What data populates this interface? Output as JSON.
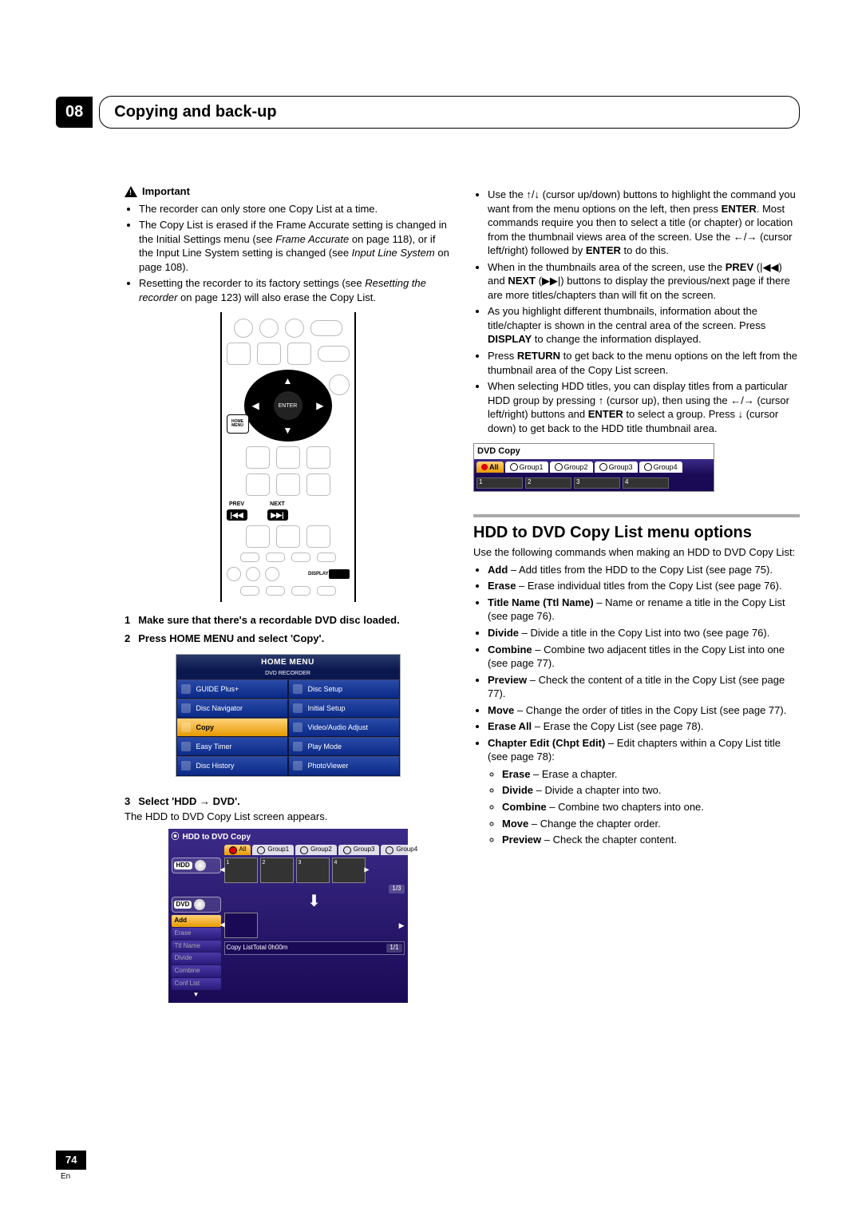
{
  "chapter": {
    "number": "08",
    "title": "Copying and back-up"
  },
  "important": {
    "label": "Important",
    "items": [
      {
        "text": "The recorder can only store one Copy List at a time."
      },
      {
        "text_parts": [
          "The Copy List is erased if the Frame Accurate setting is changed in the Initial Settings menu (see ",
          "Frame Accurate",
          " on page 118), or if the Input Line System setting is changed (see ",
          "Input Line System",
          " on page 108)."
        ]
      },
      {
        "text_parts": [
          "Resetting the recorder to its factory settings (see ",
          "Resetting the recorder",
          " on page 123) will also erase the Copy List."
        ]
      }
    ]
  },
  "remote": {
    "enter": "ENTER",
    "home_menu": "HOME\nMENU",
    "prev": "PREV",
    "next": "NEXT",
    "display": "DISPLAY"
  },
  "steps": {
    "s1": {
      "num": "1",
      "text": "Make sure that there's a recordable DVD disc loaded."
    },
    "s2": {
      "num": "2",
      "text": "Press HOME MENU and select 'Copy'."
    },
    "s3": {
      "num": "3",
      "text": "Select 'HDD → DVD'."
    },
    "s3_sub": "The HDD to DVD Copy List screen appears."
  },
  "home_menu": {
    "header": "HOME MENU",
    "sub": "DVD RECORDER",
    "left": [
      "GUIDE Plus+",
      "Disc Navigator",
      "Copy",
      "Easy Timer",
      "Disc History"
    ],
    "right": [
      "Disc Setup",
      "Initial Setup",
      "Video/Audio Adjust",
      "Play Mode",
      "PhotoViewer"
    ]
  },
  "copy_fig": {
    "title": "HDD to DVD Copy",
    "tabs": [
      "All",
      "Group1",
      "Group2",
      "Group3",
      "Group4"
    ],
    "hdd": "HDD",
    "dvd": "DVD",
    "thumbs": [
      "1",
      "2",
      "3",
      "4"
    ],
    "page1": "1/3",
    "copylist": "Copy List",
    "total": "Total  0h00m",
    "page2": "1/1",
    "menu": [
      "Add",
      "Erase",
      "Ttl Name",
      "Divide",
      "Combine",
      "Conf List"
    ]
  },
  "right_bullets": [
    {
      "parts": [
        "Use the ",
        "↑",
        "/",
        "↓",
        " (cursor up/down) buttons to highlight the command you want from the menu options on the left, then press ",
        "ENTER",
        ". Most commands require you then to select a title (or chapter) or location from the thumbnail views area of the screen. Use the ",
        "←",
        "/",
        "→",
        " (cursor left/right) followed by ",
        "ENTER",
        " to do this."
      ]
    },
    {
      "parts": [
        "When in the thumbnails area of the screen, use the ",
        "PREV",
        " (|◀◀) and ",
        "NEXT",
        " (▶▶|) buttons to display the previous/next page if there are more titles/chapters than will fit on the screen."
      ]
    },
    {
      "parts": [
        "As you highlight different thumbnails, information about the title/chapter is shown in the central area of the screen. Press ",
        "DISPLAY",
        " to change the information displayed."
      ]
    },
    {
      "parts": [
        "Press ",
        "RETURN",
        " to get back to the menu options on the left from the thumbnail area of the Copy List screen."
      ]
    },
    {
      "parts": [
        "When selecting HDD titles, you can display titles from a particular HDD group by pressing ",
        "↑",
        " (cursor up), then using the ",
        "←",
        "/",
        "→",
        " (cursor left/right) buttons and ",
        "ENTER",
        " to select a group. Press ",
        "↓",
        " (cursor down) to get back to the HDD title thumbnail area."
      ]
    }
  ],
  "dvd_copy_small": {
    "label": "DVD Copy",
    "tabs": [
      "All",
      "Group1",
      "Group2",
      "Group3",
      "Group4"
    ],
    "thumbs": [
      "1",
      "2",
      "3",
      "4"
    ]
  },
  "section2": {
    "heading": "HDD to DVD Copy List menu options",
    "intro": "Use the following commands when making an HDD to DVD Copy List:",
    "items": [
      {
        "name": "Add",
        "desc": " – Add titles from the HDD to the Copy List (see page 75)."
      },
      {
        "name": "Erase",
        "desc": " – Erase individual titles from the Copy List (see page 76)."
      },
      {
        "name": "Title Name",
        "paren": " (Ttl Name)",
        "desc": " – Name or rename a title in the Copy List (see page 76)."
      },
      {
        "name": "Divide",
        "desc": " – Divide a title in the Copy List into two (see page 76)."
      },
      {
        "name": "Combine",
        "desc": " – Combine two adjacent titles in the Copy List into one (see page 77)."
      },
      {
        "name": "Preview",
        "desc": " – Check the content of a title in the Copy List (see page 77)."
      },
      {
        "name": "Move",
        "desc": " – Change the order of titles in the Copy List (see page 77)."
      },
      {
        "name": "Erase All",
        "desc": " – Erase the Copy List (see page 78)."
      },
      {
        "name": "Chapter Edit",
        "paren": " (Chpt Edit)",
        "desc": " – Edit chapters within a Copy List title (see page 78):",
        "sub": [
          {
            "name": "Erase",
            "desc": " – Erase a chapter."
          },
          {
            "name": "Divide",
            "desc": " – Divide a chapter into two."
          },
          {
            "name": "Combine",
            "desc": " – Combine two chapters into one."
          },
          {
            "name": "Move",
            "desc": " – Change the chapter order."
          },
          {
            "name": "Preview",
            "desc": " – Check the chapter content."
          }
        ]
      }
    ]
  },
  "footer": {
    "page": "74",
    "lang": "En"
  }
}
